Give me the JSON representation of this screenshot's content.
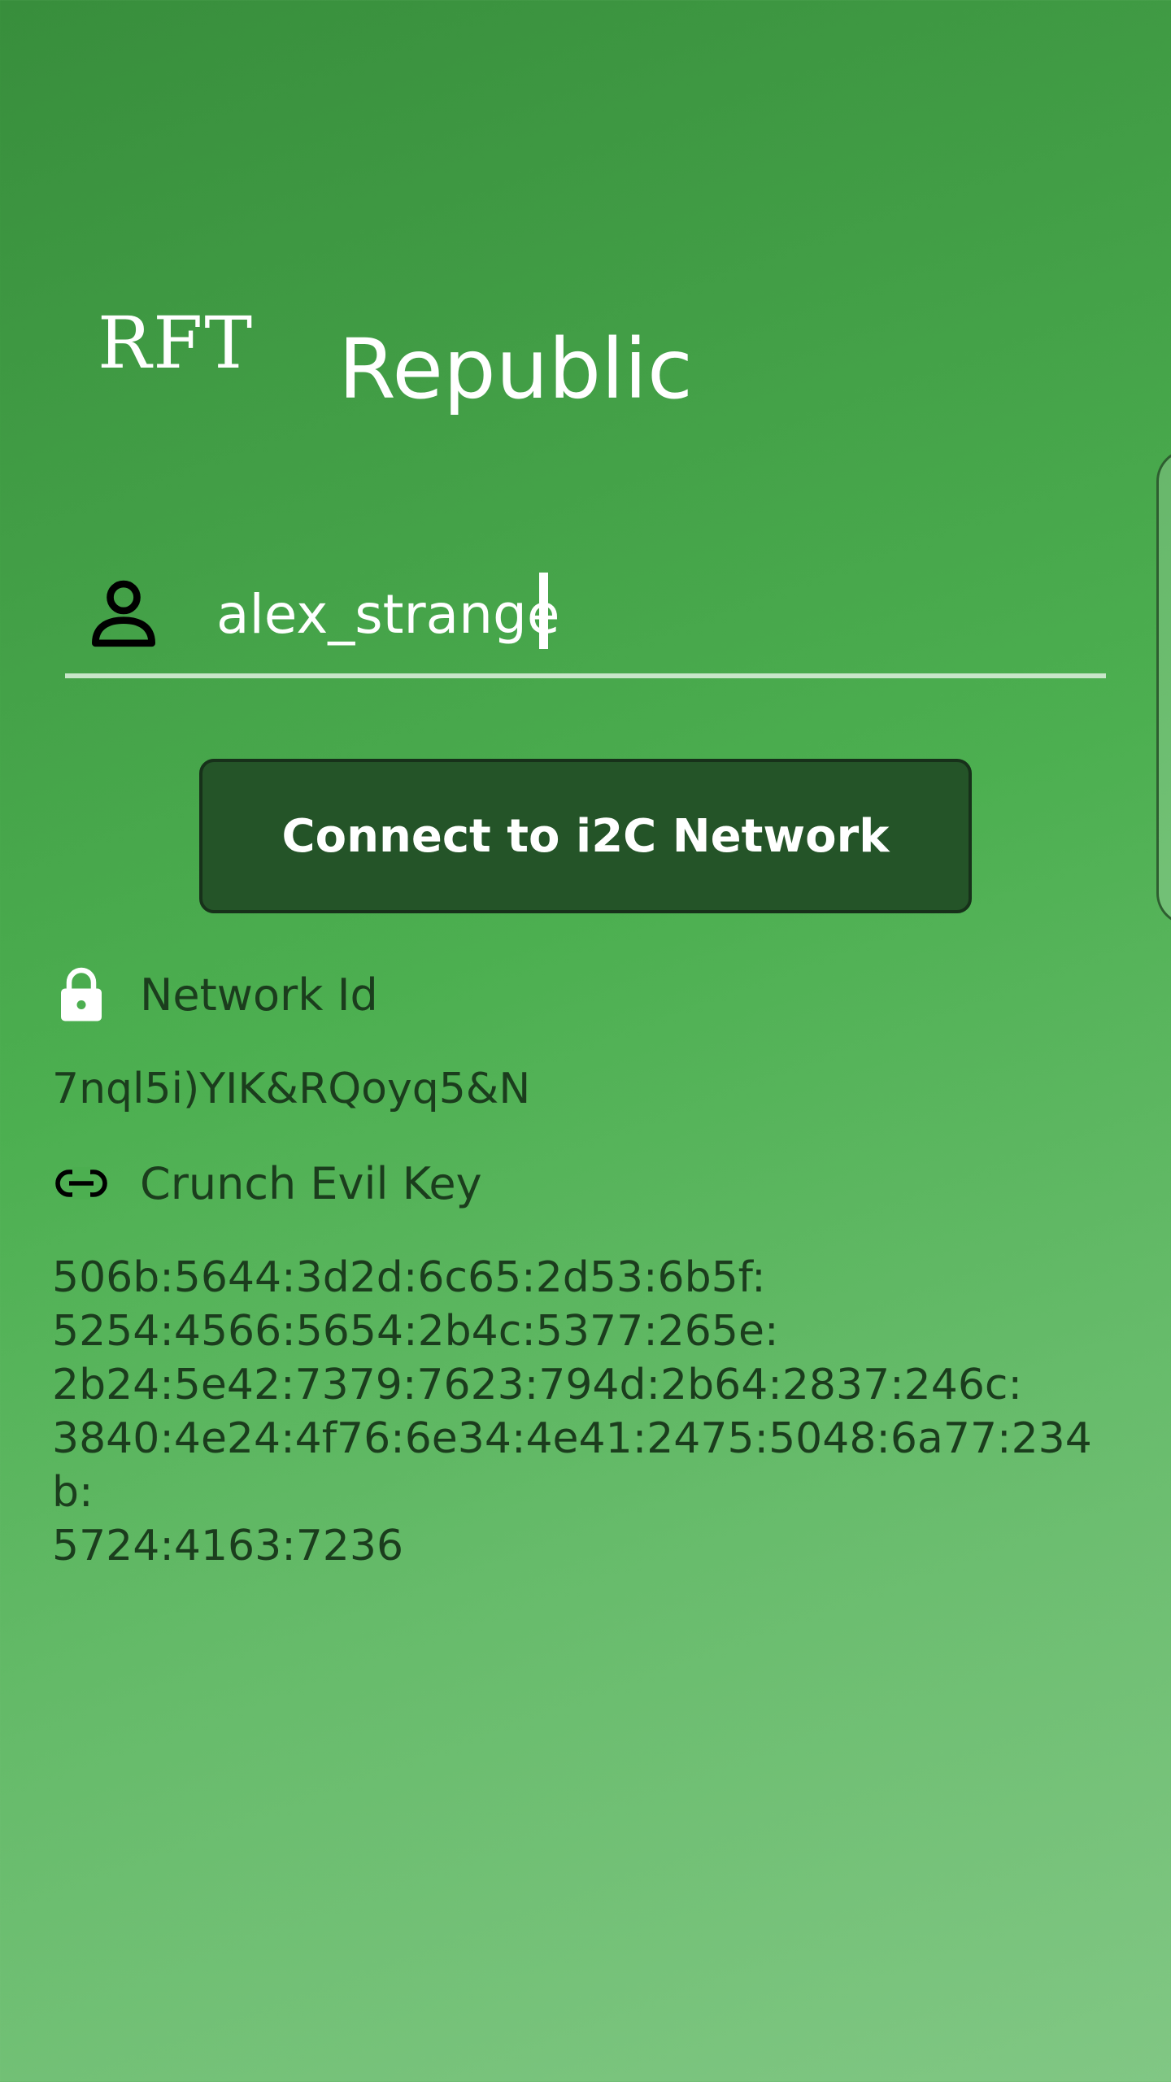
{
  "header": {
    "logo_text": "RFT",
    "app_title": "Republic"
  },
  "login": {
    "username_value": "alex_strange",
    "connect_label": "Connect to i2C Network"
  },
  "network": {
    "id_label": "Network Id",
    "id_value": "7nql5i)YIK&RQoyq5&N",
    "key_label": "Crunch Evil Key",
    "key_value": "506b:5644:3d2d:6c65:2d53:6b5f:\n5254:4566:5654:2b4c:5377:265e:\n2b24:5e42:7379:7623:794d:2b64:2837:246c:\n3840:4e24:4f76:6e34:4e41:2475:5048:6a77:234b:\n5724:4163:7236"
  },
  "icons": {
    "user": "person-icon",
    "lock": "lock-icon",
    "link": "link-icon"
  }
}
